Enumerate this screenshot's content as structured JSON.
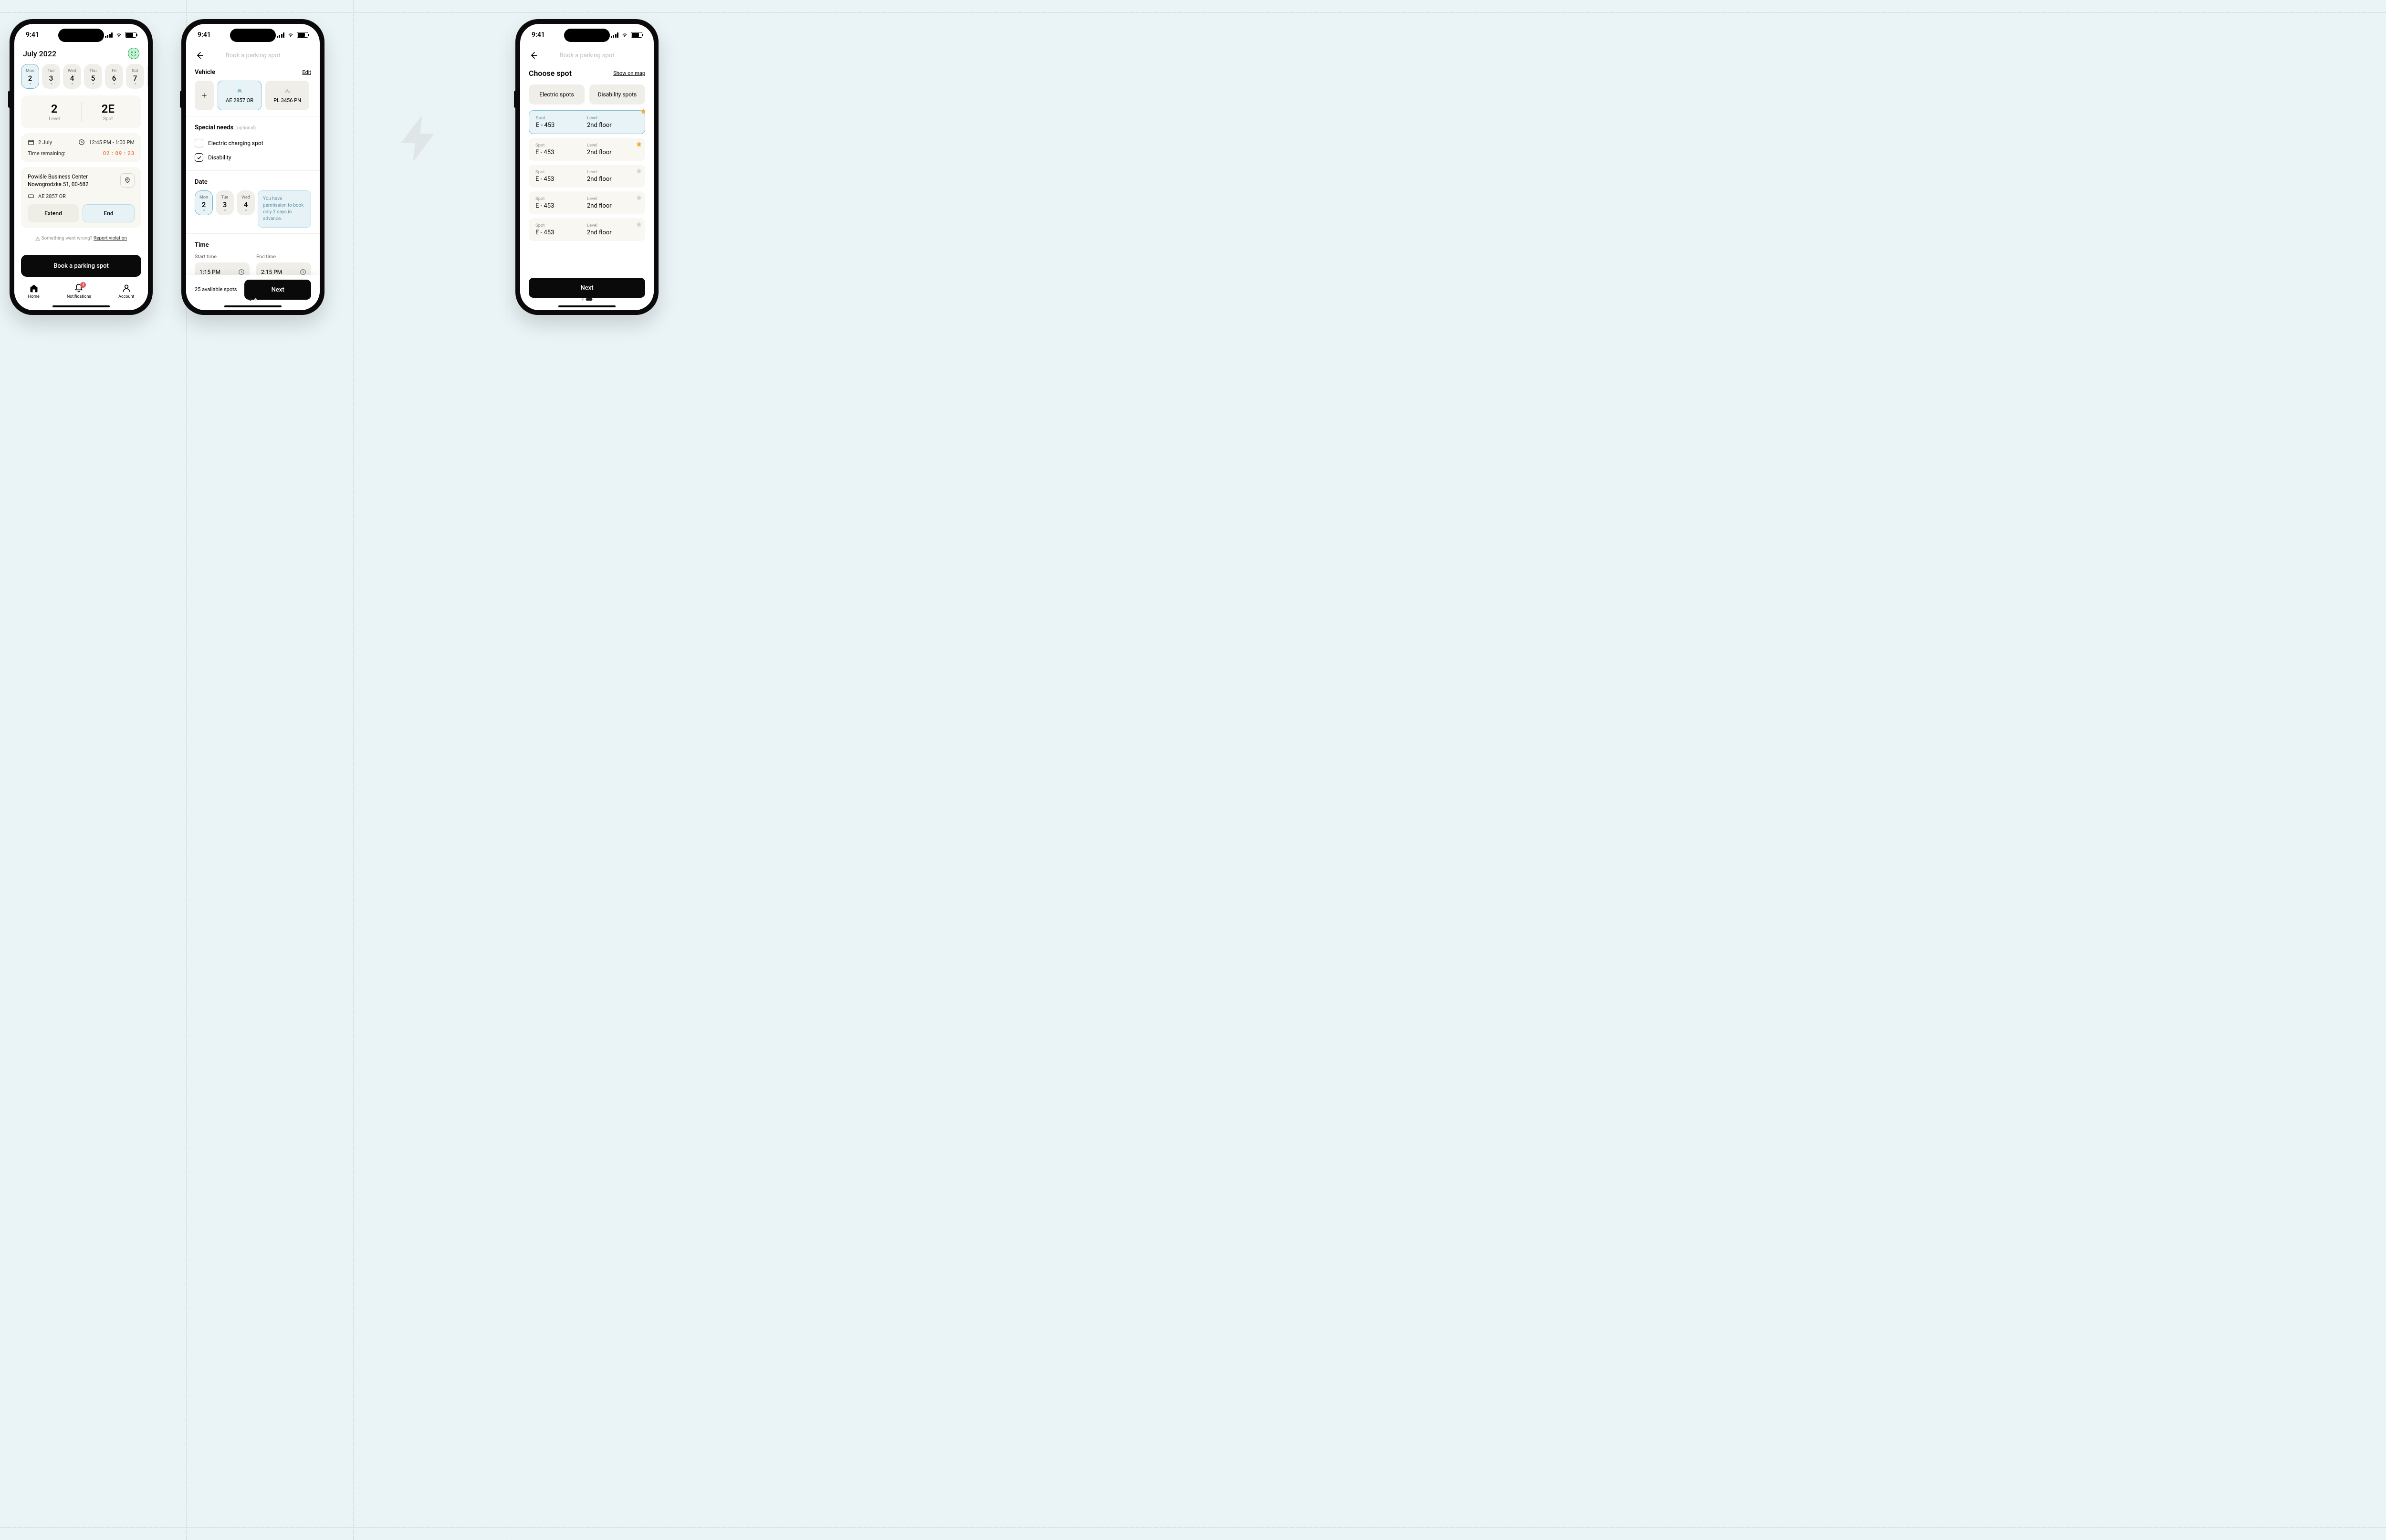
{
  "statusbar": {
    "time": "9:41"
  },
  "screen1": {
    "header": {
      "month": "July 2022"
    },
    "week": [
      {
        "dow": "Mon",
        "num": "2",
        "selected": true
      },
      {
        "dow": "Tue",
        "num": "3"
      },
      {
        "dow": "Wed",
        "num": "4"
      },
      {
        "dow": "Thu",
        "num": "5"
      },
      {
        "dow": "Fri",
        "num": "6"
      },
      {
        "dow": "Sat",
        "num": "7"
      }
    ],
    "summary": {
      "level_value": "2",
      "level_label": "Level",
      "spot_value": "2E",
      "spot_label": "Spot"
    },
    "details": {
      "date": "2 July",
      "time_range": "12:45 PM - 1:00 PM",
      "remaining_label": "Time remaining:",
      "remaining_value": "02 : 09 : 23",
      "location_name": "Powiśle Business Center",
      "location_addr": "Nowogrodzka 51, 00-682",
      "plate": "AE 2857 OR",
      "extend_label": "Extend",
      "end_label": "End"
    },
    "warning": {
      "text": "Something went wrong?",
      "link": "Report violation"
    },
    "cta": "Book a parking spot",
    "tabs": {
      "home": "Home",
      "notifications": "Notifications",
      "notifications_badge": "4",
      "account": "Account"
    }
  },
  "screen2": {
    "title": "Book a parking spot",
    "vehicle": {
      "label": "Vehicle",
      "edit": "Edit",
      "plates": [
        {
          "id": "AE 2857 OR",
          "selected": true,
          "type": "car"
        },
        {
          "id": "PL 3456 PN",
          "selected": false,
          "type": "moto"
        }
      ]
    },
    "special": {
      "label": "Special needs",
      "optional": "(optional)",
      "electric": "Electric charging spot",
      "disability": "Disability",
      "disability_checked": true
    },
    "date": {
      "label": "Date",
      "days": [
        {
          "dow": "Mon",
          "num": "2",
          "selected": true
        },
        {
          "dow": "Tue",
          "num": "3"
        },
        {
          "dow": "Wed",
          "num": "4"
        }
      ],
      "notice": "You have permission to book only 2 days in advance."
    },
    "time": {
      "label": "Time",
      "start_label": "Start time",
      "end_label": "End time",
      "start_value": "1:15 PM",
      "end_value": "2:15 PM"
    },
    "footer": {
      "available": "25 available spots",
      "next": "Next"
    }
  },
  "screen3": {
    "title": "Book a parking spot",
    "header": {
      "label": "Choose spot",
      "map_link": "Show on map"
    },
    "filters": {
      "electric": "Electric spots",
      "disability": "Disability spots"
    },
    "spot_labels": {
      "spot": "Spot",
      "level": "Level"
    },
    "spots": [
      {
        "spot": "E - 453",
        "level": "2nd floor",
        "fav": true,
        "selected": true
      },
      {
        "spot": "E - 453",
        "level": "2nd floor",
        "fav": true
      },
      {
        "spot": "E - 453",
        "level": "2nd floor",
        "fav": false
      },
      {
        "spot": "E - 453",
        "level": "2nd floor",
        "fav": false
      },
      {
        "spot": "E - 453",
        "level": "2nd floor",
        "fav": false
      }
    ],
    "next": "Next"
  }
}
